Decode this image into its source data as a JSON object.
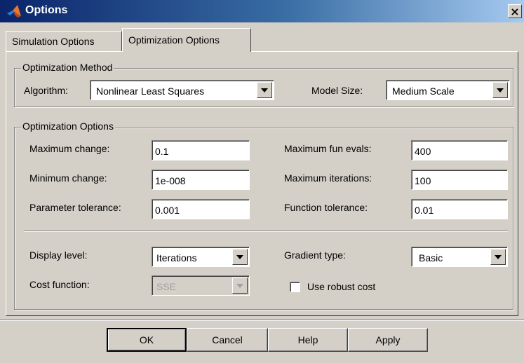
{
  "window": {
    "title": "Options",
    "close_glyph": "×",
    "icon": "matlab-logo-icon"
  },
  "tabs": [
    {
      "label": "Simulation Options",
      "active": false
    },
    {
      "label": "Optimization Options",
      "active": true
    }
  ],
  "method_group": {
    "legend": "Optimization Method",
    "algorithm_label": "Algorithm:",
    "algorithm_value": "Nonlinear Least Squares",
    "model_size_label": "Model Size:",
    "model_size_value": "Medium Scale"
  },
  "options_group": {
    "legend": "Optimization Options",
    "max_change_label": "Maximum change:",
    "max_change_value": "0.1",
    "min_change_label": "Minimum change:",
    "min_change_value": "1e-008",
    "param_tol_label": "Parameter tolerance:",
    "param_tol_value": "0.001",
    "max_fun_evals_label": "Maximum fun evals:",
    "max_fun_evals_value": "400",
    "max_iter_label": "Maximum iterations:",
    "max_iter_value": "100",
    "func_tol_label": "Function tolerance:",
    "func_tol_value": "0.01",
    "display_level_label": "Display level:",
    "display_level_value": "Iterations",
    "cost_function_label": "Cost function:",
    "cost_function_value": "SSE",
    "gradient_type_label": "Gradient type:",
    "gradient_type_value": "Basic",
    "robust_cost_label": "Use robust cost",
    "robust_cost_checked": false
  },
  "buttons": {
    "ok": "OK",
    "cancel": "Cancel",
    "help": "Help",
    "apply": "Apply"
  }
}
